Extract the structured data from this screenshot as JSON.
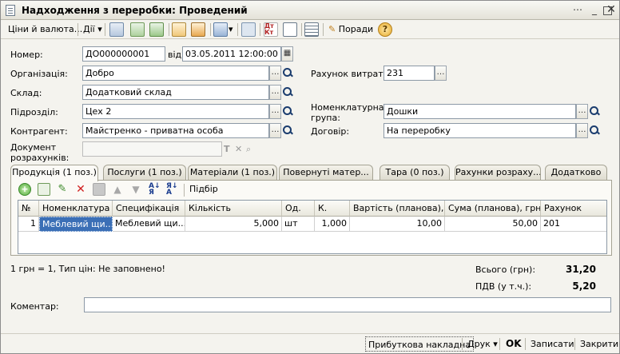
{
  "window": {
    "title": "Надходження з переробки: Проведений"
  },
  "toolbar": {
    "prices_label": "Ціни й валюта...",
    "actions_label": "Дії",
    "tips_label": "Поради"
  },
  "header": {
    "number_label": "Номер:",
    "number_value": "ДО000000001",
    "date_label": "від:",
    "date_value": "03.05.2011 12:00:00",
    "organization_label": "Організація:",
    "organization_value": "Добро",
    "expense_account_label": "Рахунок витрат:",
    "expense_account_value": "231",
    "warehouse_label": "Склад:",
    "warehouse_value": "Додатковий склад",
    "department_label": "Підрозділ:",
    "department_value": "Цех 2",
    "nomenclature_group_label_1": "Номенклатурна",
    "nomenclature_group_label_2": "група:",
    "nomenclature_group_value": "Дошки",
    "counterparty_label": "Контрагент:",
    "counterparty_value": "Майстренко - приватна особа",
    "contract_label": "Договір:",
    "contract_value": "На переробку",
    "settlement_doc_label_1": "Документ",
    "settlement_doc_label_2": "розрахунків:",
    "settlement_doc_value": ""
  },
  "tabs": [
    {
      "label": "Продукція (1 поз.)"
    },
    {
      "label": "Послуги (1 поз.)"
    },
    {
      "label": "Матеріали (1 поз.)"
    },
    {
      "label": "Повернуті матер..."
    },
    {
      "label": "Тара (0 поз.)"
    },
    {
      "label": "Рахунки розраху..."
    },
    {
      "label": "Додатково"
    }
  ],
  "tab_toolbar": {
    "selection_label": "Підбір"
  },
  "table": {
    "columns": [
      "№",
      "Номенклатура",
      "Специфікація",
      "Кількість",
      "Од.",
      "К.",
      "Вартість (планова), ...",
      "Сума (планова), грн.",
      "Рахунок"
    ],
    "rows": [
      [
        "1",
        "Меблевий щи...",
        "Меблевий щи...",
        "5,000",
        "шт",
        "1,000",
        "10,00",
        "50,00",
        "201"
      ]
    ]
  },
  "footer": {
    "currency_note": "1 грн = 1, Тип цін: Не заповнено!",
    "total_label": "Всього (грн):",
    "total_value": "31,20",
    "vat_label": "ПДВ (у т.ч.):",
    "vat_value": "5,20",
    "comment_label": "Коментар:",
    "comment_value": ""
  },
  "bottom_buttons": {
    "receipt_invoice": "Прибуткова накладна",
    "print": "Друк",
    "ok": "OK",
    "save": "Записати",
    "close": "Закрити"
  }
}
